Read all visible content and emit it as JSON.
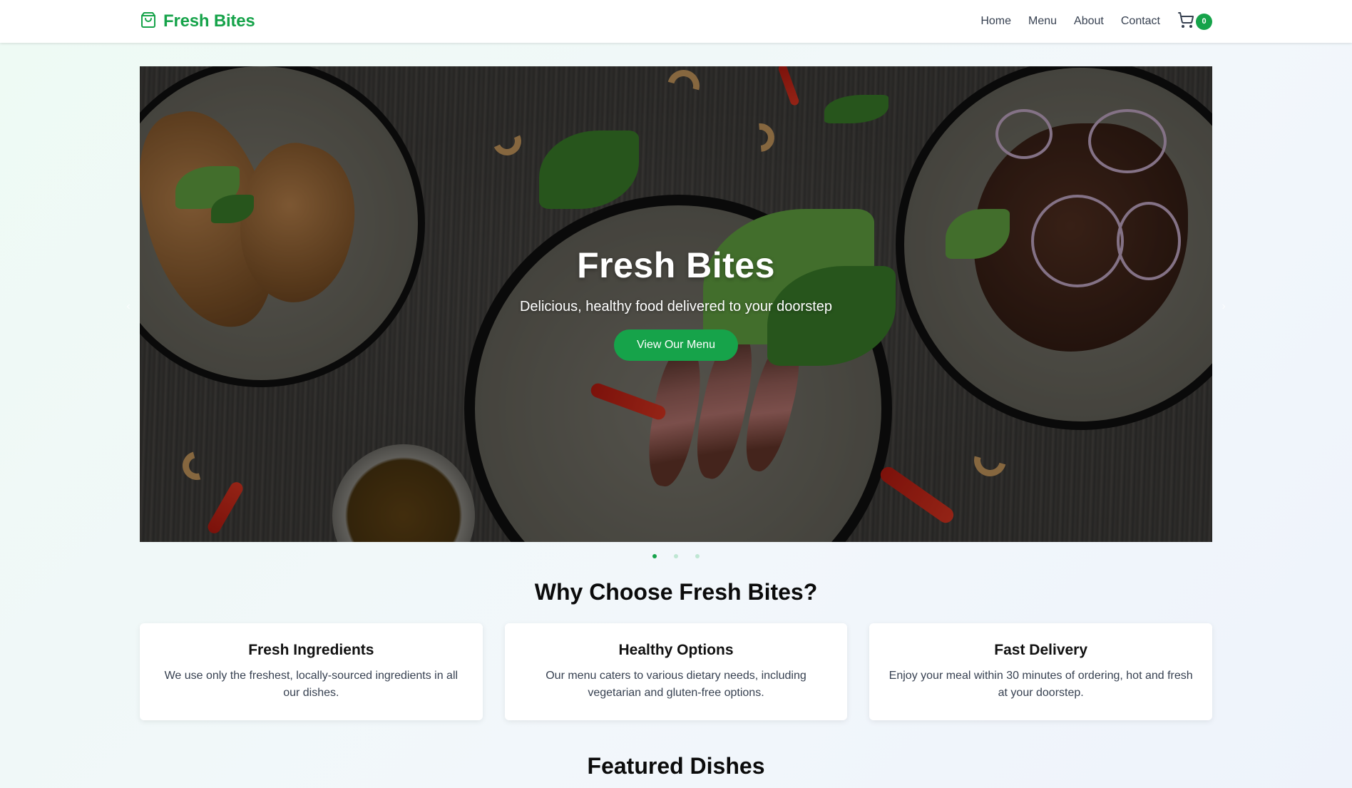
{
  "brand": {
    "name": "Fresh Bites",
    "icon": "shopping-bag-icon",
    "color": "#16a34a"
  },
  "nav": {
    "links": [
      "Home",
      "Menu",
      "About",
      "Contact"
    ],
    "cart_icon": "cart-icon",
    "cart_count": "0"
  },
  "hero": {
    "title": "Fresh Bites",
    "subtitle": "Delicious, healthy food delivered to your doorstep",
    "button_label": "View Our Menu",
    "prev_arrow": "‹",
    "next_arrow": "›",
    "slides_total": 3,
    "active_slide": 1
  },
  "why": {
    "title": "Why Choose Fresh Bites?",
    "cards": [
      {
        "title": "Fresh Ingredients",
        "text": "We use only the freshest, locally-sourced ingredients in all our dishes."
      },
      {
        "title": "Healthy Options",
        "text": "Our menu caters to various dietary needs, including vegetarian and gluten-free options."
      },
      {
        "title": "Fast Delivery",
        "text": "Enjoy your meal within 30 minutes of ordering, hot and fresh at your doorstep."
      }
    ]
  },
  "featured": {
    "title": "Featured Dishes"
  },
  "colors": {
    "accent": "#16a34a",
    "dot_inactive": "#bfe6d3"
  }
}
